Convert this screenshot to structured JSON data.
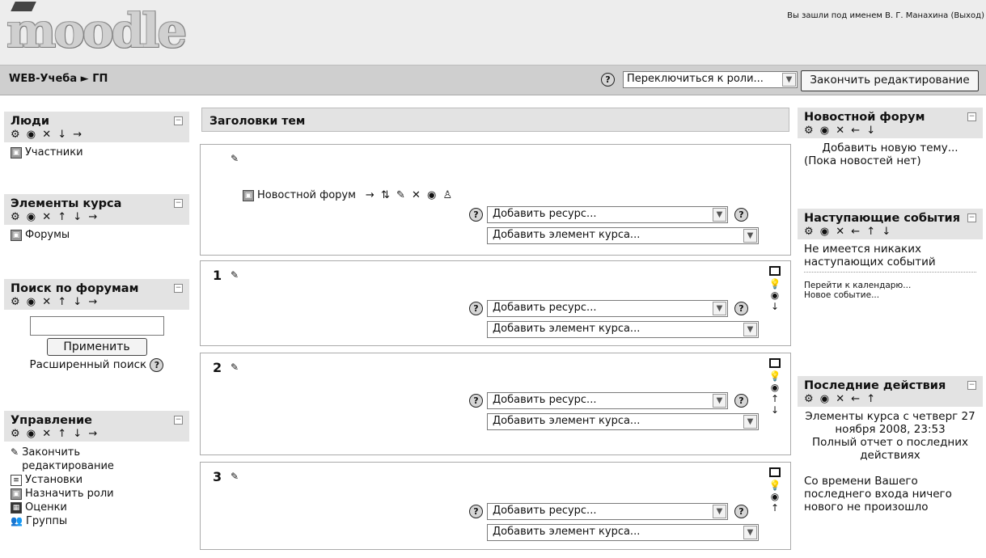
{
  "header": {
    "logo": "moodle",
    "login_prefix": "Вы зашли под именем",
    "user": "В. Г. Манахина",
    "logout": "(Выход)"
  },
  "navbar": {
    "crumb": "WEB-Учеба ► ГП",
    "role_select": "Переключиться к роли...",
    "end_edit": "Закончить редактирование"
  },
  "left": {
    "people": {
      "title": "Люди",
      "icons": "⚙ ◉ ✕ ↓ →",
      "items": [
        "Участники"
      ]
    },
    "activities": {
      "title": "Элементы курса",
      "icons": "⚙ ◉ ✕ ↑ ↓ →",
      "items": [
        "Форумы"
      ]
    },
    "search": {
      "title": "Поиск по форумам",
      "icons": "⚙ ◉ ✕ ↑ ↓ →",
      "button": "Применить",
      "advanced": "Расширенный поиск"
    },
    "admin": {
      "title": "Управление",
      "icons": "⚙ ◉ ✕ ↑ ↓ →",
      "items": [
        "Закончить редактирование",
        "Установки",
        "Назначить роли",
        "Оценки",
        "Группы"
      ]
    }
  },
  "center": {
    "topics_header": "Заголовки тем",
    "forum_link": "Новостной форум",
    "forum_icons": "→ ⇅ ✎ ✕ ◉ ♙",
    "add_resource": "Добавить ресурс...",
    "add_activity": "Добавить элемент курса...",
    "sections": [
      "1",
      "2",
      "3"
    ]
  },
  "right": {
    "news": {
      "title": "Новостной форум",
      "icons": "⚙ ◉ ✕ ← ↓",
      "add": "Добавить новую тему...",
      "none": "(Пока новостей нет)"
    },
    "upcoming": {
      "title": "Наступающие события",
      "icons": "⚙ ◉ ✕ ← ↑ ↓",
      "none": "Не имеется никаких наступающих событий",
      "calendar": "Перейти к календарю...",
      "new_event": "Новое событие..."
    },
    "recent": {
      "title": "Последние действия",
      "icons": "⚙ ◉ ✕ ← ↑",
      "since": "Элементы курса с четверг 27 ноября 2008, 23:53",
      "full": "Полный отчет о последних действиях",
      "nothing": "Со времени Вашего последнего входа ничего нового не произошло"
    }
  }
}
